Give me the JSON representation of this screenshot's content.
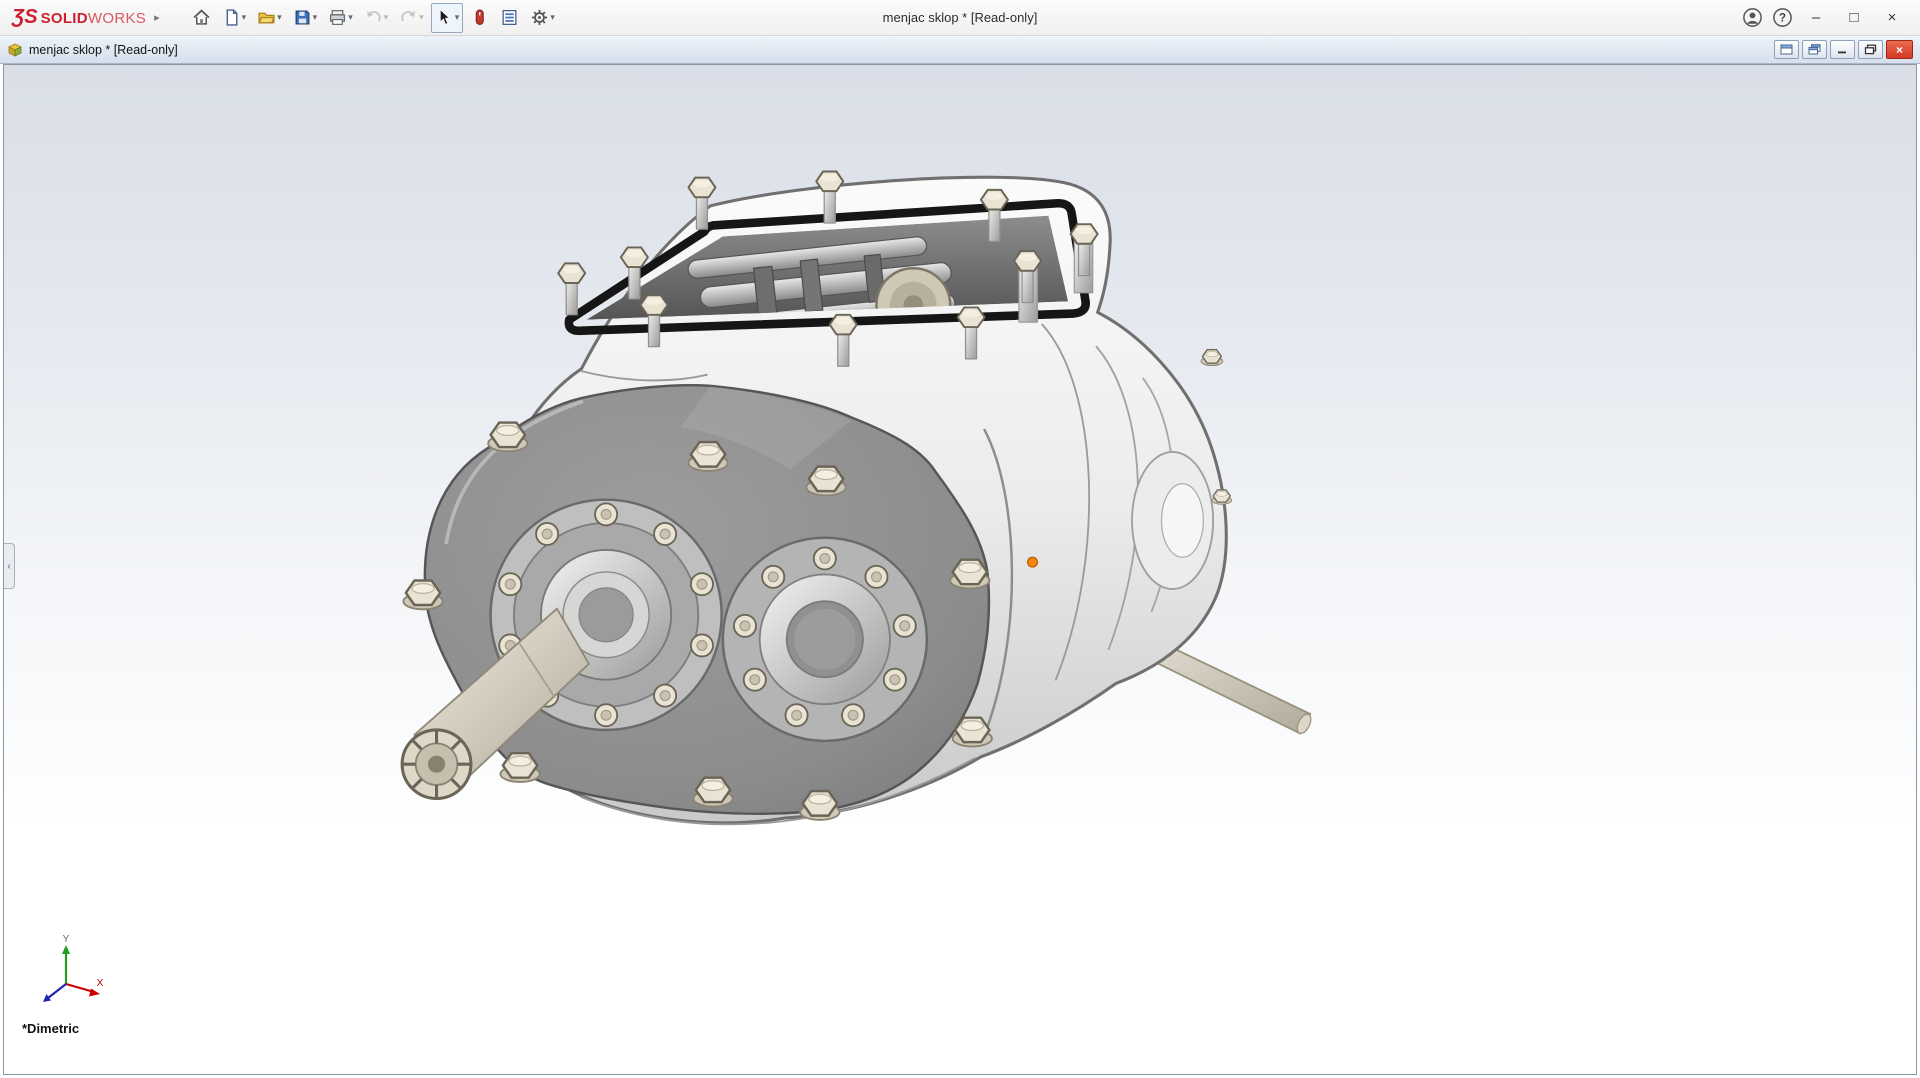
{
  "brand": {
    "logo_glyph": "ƷS",
    "name_bold": "SOLID",
    "name_light": "WORKS"
  },
  "window": {
    "title": "menjac sklop * [Read-only]"
  },
  "document_window": {
    "title": "menjac sklop * [Read-only]"
  },
  "viewport": {
    "view_orientation_label": "*Dimetric",
    "triad": {
      "x_label": "X",
      "y_label": "Y"
    }
  },
  "glyphs": {
    "brand_caret": "▸",
    "caret_down": "▾",
    "minimize": "–",
    "maximize": "□",
    "close": "×",
    "doc_close": "×",
    "collapse_arrow": "‹",
    "help": "?"
  },
  "icons": {
    "toolbar": [
      "home-icon",
      "new-document-icon",
      "open-icon",
      "save-icon",
      "print-icon",
      "undo-icon",
      "redo-icon",
      "select-cursor-icon",
      "mouse-gestures-icon",
      "document-properties-icon",
      "settings-gear-icon"
    ],
    "titlebar_right": [
      "account-icon",
      "help-icon",
      "minimize-icon",
      "maximize-icon",
      "close-icon"
    ],
    "docbar": [
      "assembly-document-icon",
      "new-window-icon",
      "cascade-windows-icon",
      "minimize-icon",
      "restore-icon",
      "close-icon"
    ]
  },
  "colors": {
    "brand_red": "#cf1f2e",
    "doc_close_red": "#d23a24",
    "selection_orange": "#f5870f",
    "triad_x": "#cc0000",
    "triad_y": "#1f9d1f",
    "triad_z": "#2222bb"
  }
}
